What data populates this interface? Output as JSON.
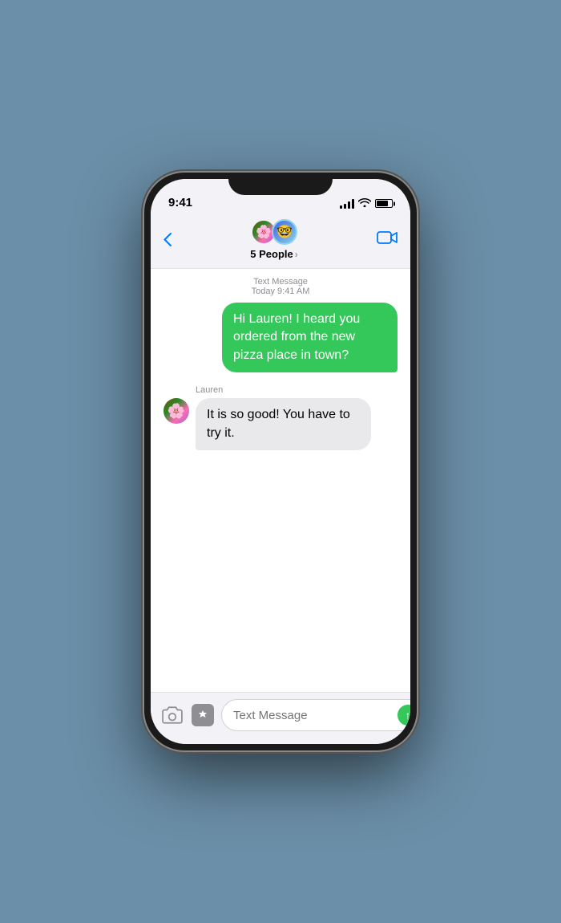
{
  "status_bar": {
    "time": "9:41",
    "signal_bars": [
      4,
      6,
      8,
      10,
      12
    ],
    "wifi": "wifi",
    "battery_level": 80
  },
  "nav_header": {
    "back_label": "Back",
    "group_name": "5 People",
    "group_chevron": ">",
    "video_button_label": "Video call"
  },
  "messages": {
    "meta_type": "Text Message",
    "meta_time": "Today 9:41 AM",
    "outgoing_message": "Hi Lauren! I heard you ordered from the new pizza place in town?",
    "incoming_sender": "Lauren",
    "incoming_message": "It is so good! You have to try it."
  },
  "input_bar": {
    "placeholder": "Text Message",
    "camera_label": "Camera",
    "appstore_label": "App Store",
    "send_label": "Send"
  },
  "avatars": {
    "avatar1_emoji": "🌸",
    "avatar2_emoji": "🤓"
  }
}
